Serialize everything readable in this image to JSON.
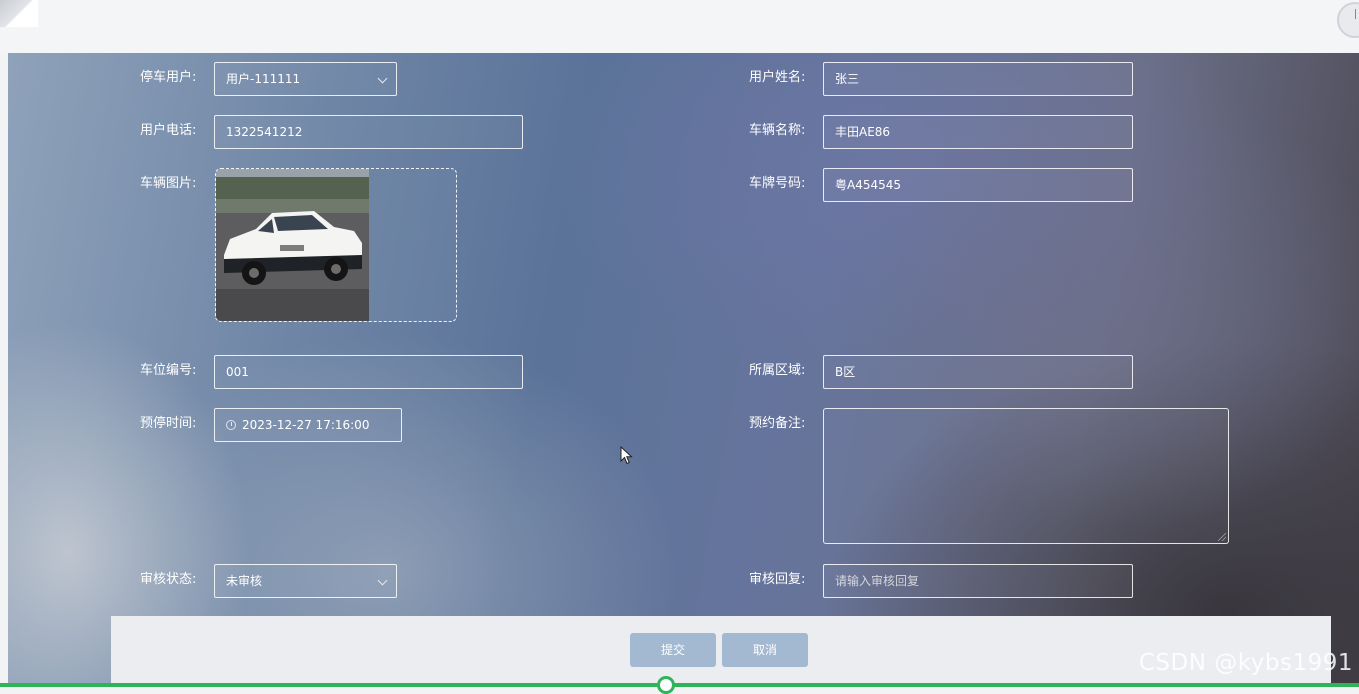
{
  "form": {
    "parking_user": {
      "label": "停车用户:",
      "value": "用户-111111"
    },
    "user_name": {
      "label": "用户姓名:",
      "value": "张三"
    },
    "user_phone": {
      "label": "用户电话:",
      "value": "1322541212"
    },
    "vehicle_name": {
      "label": "车辆名称:",
      "value": "丰田AE86"
    },
    "vehicle_image": {
      "label": "车辆图片:"
    },
    "plate_number": {
      "label": "车牌号码:",
      "value": "粤A454545"
    },
    "spot_number": {
      "label": "车位编号:",
      "value": "001"
    },
    "area": {
      "label": "所属区域:",
      "value": "B区"
    },
    "reserve_time": {
      "label": "预停时间:",
      "value": "2023-12-27 17:16:00"
    },
    "reserve_note": {
      "label": "预约备注:",
      "value": ""
    },
    "review_status": {
      "label": "审核状态:",
      "value": "未审核"
    },
    "review_reply": {
      "label": "审核回复:",
      "placeholder": "请输入审核回复"
    }
  },
  "buttons": {
    "submit": "提交",
    "cancel": "取消"
  },
  "watermark": "CSDN @kybs1991",
  "colors": {
    "button": "#a3b8d1",
    "progress": "#2fb45a"
  }
}
